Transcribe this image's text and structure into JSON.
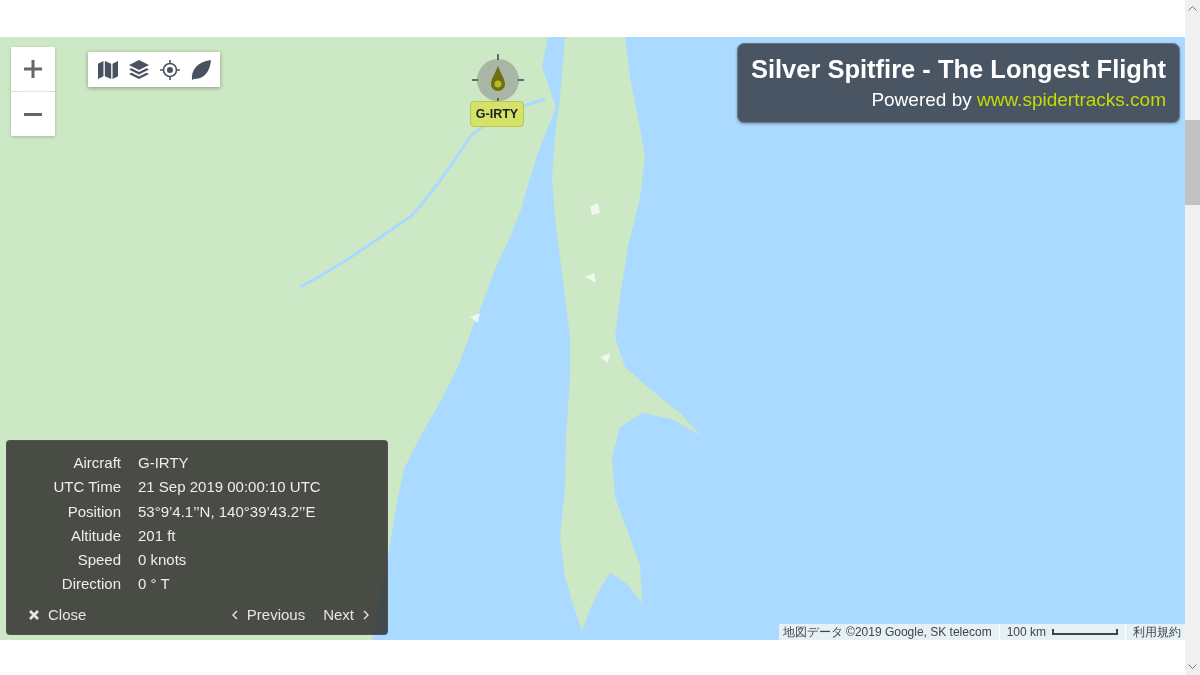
{
  "map": {
    "marker": {
      "label": "G-IRTY"
    }
  },
  "title_panel": {
    "title": "Silver Spitfire - The Longest Flight",
    "powered_by": "Powered by",
    "link": "www.spidertracks.com"
  },
  "info_panel": {
    "rows": [
      {
        "label": "Aircraft",
        "value": "G-IRTY"
      },
      {
        "label": "UTC Time",
        "value": "21 Sep 2019 00:00:10 UTC"
      },
      {
        "label": "Position",
        "value": "53°9’4.1’’N, 140°39’43.2’’E"
      },
      {
        "label": "Altitude",
        "value": "201 ft"
      },
      {
        "label": "Speed",
        "value": "0 knots"
      },
      {
        "label": "Direction",
        "value": "0 ° T"
      }
    ],
    "close": "Close",
    "previous": "Previous",
    "next": "Next"
  },
  "attribution": {
    "map_data": "地図データ ©2019 Google, SK telecom",
    "scale": "100 km",
    "terms": "利用規約"
  }
}
